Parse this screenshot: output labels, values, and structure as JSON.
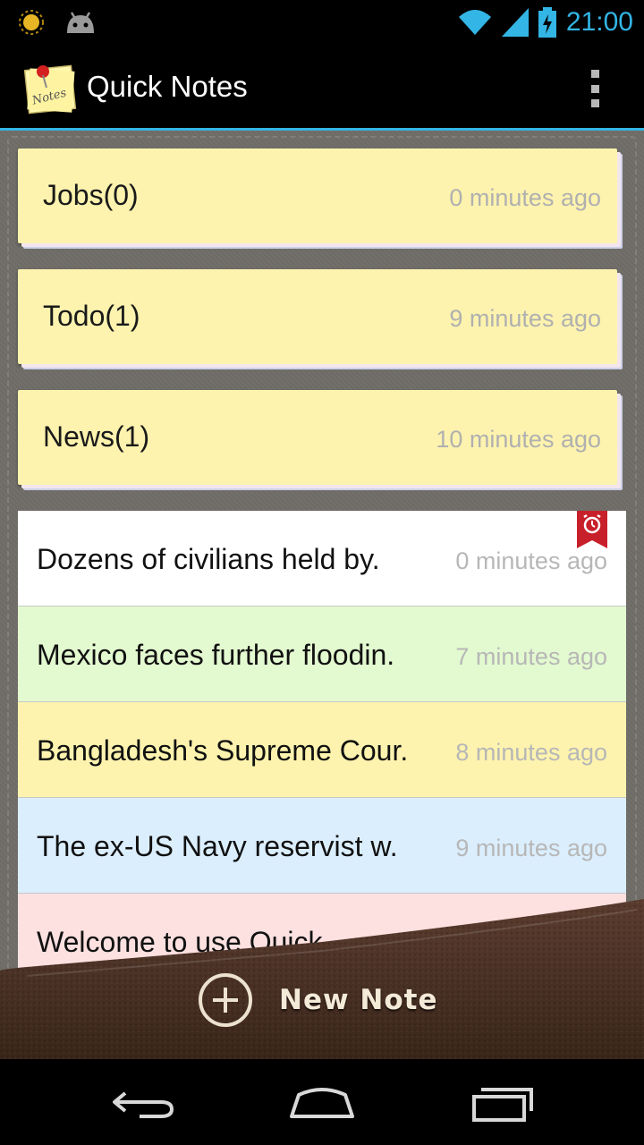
{
  "status_bar": {
    "time": "21:00",
    "icons": [
      "sun-icon",
      "android-icon",
      "wifi-icon",
      "signal-icon",
      "battery-charging-icon"
    ]
  },
  "action_bar": {
    "app_icon": "notes-pin-icon",
    "app_icon_text": "Notes",
    "title": "Quick Notes",
    "menu_icon": "overflow-menu-icon"
  },
  "folders": [
    {
      "name": "Jobs(0)",
      "time": "0 minutes ago"
    },
    {
      "name": "Todo(1)",
      "time": "9 minutes ago"
    },
    {
      "name": "News(1)",
      "time": "10 minutes ago"
    }
  ],
  "notes": [
    {
      "title": "Dozens of civilians held by.",
      "time": "0 minutes ago",
      "color": "#ffffff",
      "has_alarm": true
    },
    {
      "title": "Mexico faces further floodin.",
      "time": "7 minutes ago",
      "color": "#e3fad0",
      "has_alarm": false
    },
    {
      "title": "Bangladesh's Supreme Cour.",
      "time": "8 minutes ago",
      "color": "#fdf3ae",
      "has_alarm": false
    },
    {
      "title": "The ex-US Navy reservist w.",
      "time": "9 minutes ago",
      "color": "#dbeefd",
      "has_alarm": false
    },
    {
      "title": "Welcome to use Quick",
      "time": "",
      "color": "#fde0e0",
      "has_alarm": false
    }
  ],
  "bottom_bar": {
    "new_note_label": "New Note",
    "icon": "plus-circle-icon"
  },
  "nav_bar": {
    "icons": [
      "back-icon",
      "home-icon",
      "recent-apps-icon"
    ]
  },
  "colors": {
    "accent": "#33b5e5",
    "folder": "#fdf3ae",
    "leather": "#4a3125"
  }
}
